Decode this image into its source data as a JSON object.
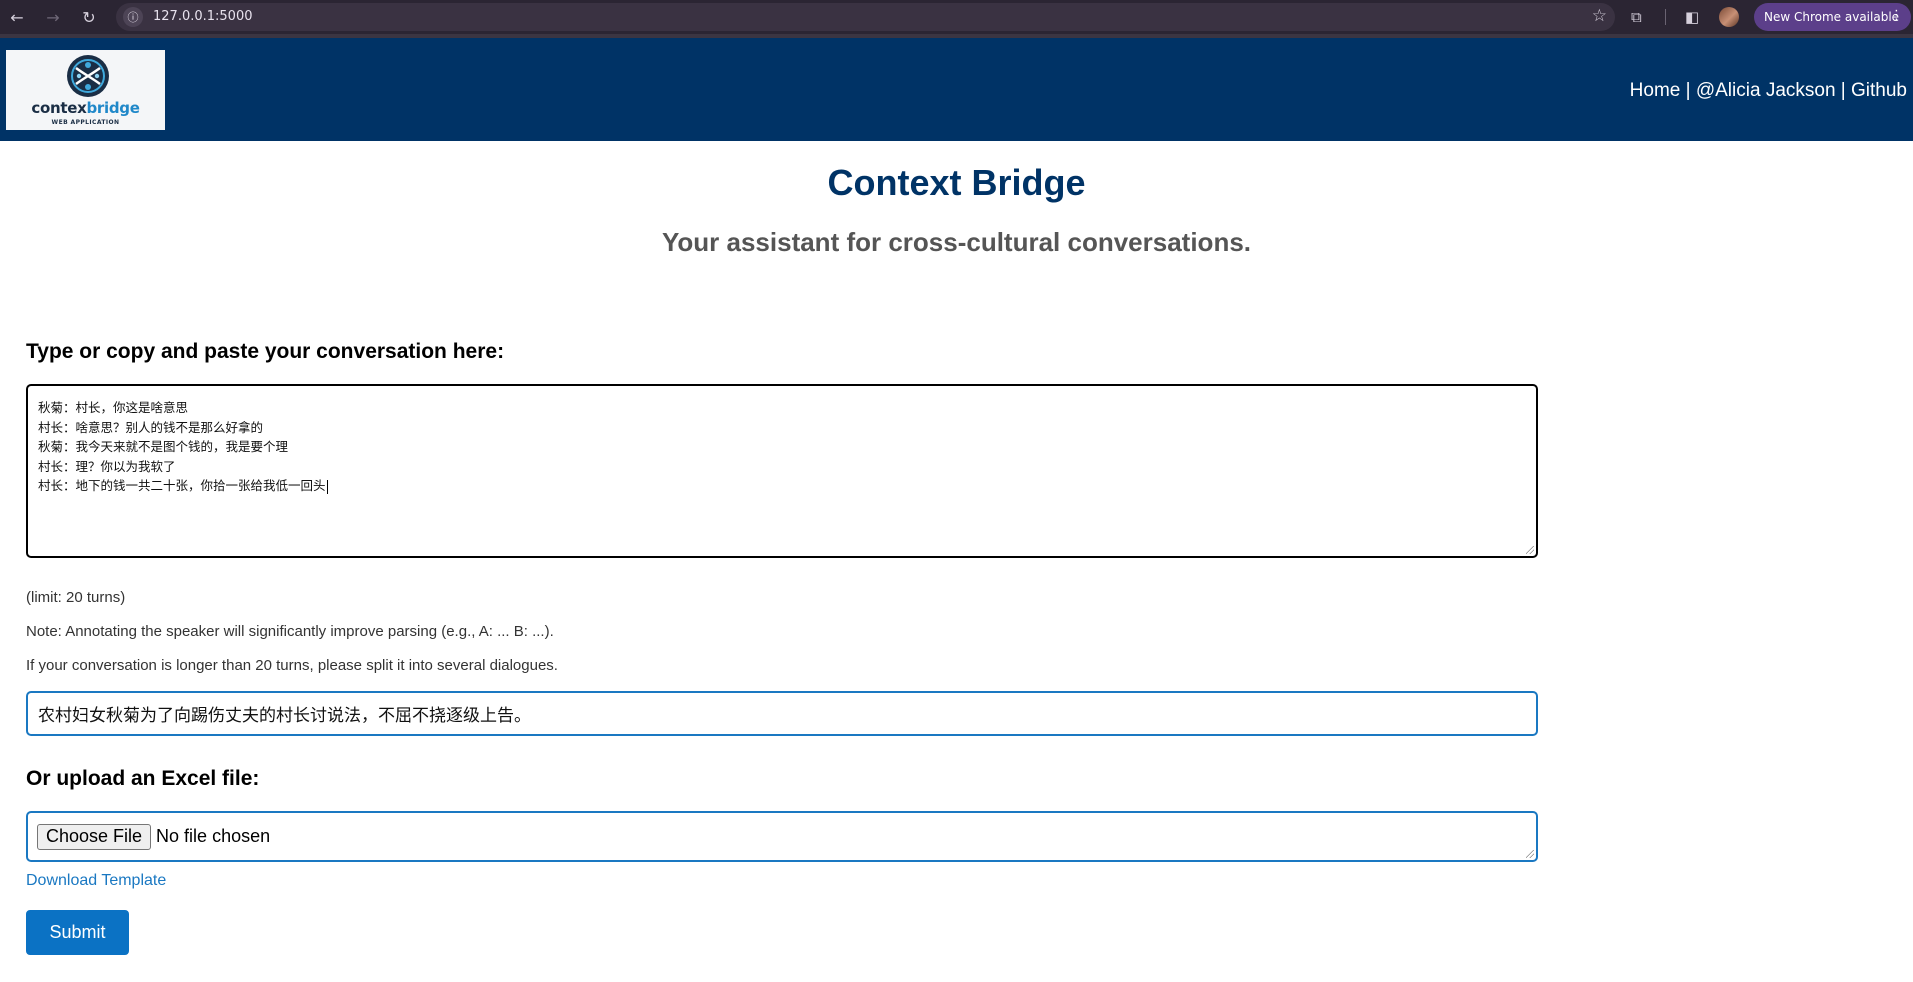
{
  "browser": {
    "url": "127.0.0.1:5000",
    "update_label": "New Chrome available",
    "icons": [
      "back-arrow-icon",
      "forward-arrow-icon",
      "reload-icon",
      "site-info-icon",
      "bookmark-star-icon",
      "extensions-icon",
      "side-panel-icon",
      "profile-avatar",
      "menu-dots-icon"
    ]
  },
  "header": {
    "logo_text_main": "contex",
    "logo_text_accent": "bridge",
    "logo_subtext": "WEB APPLICATION",
    "nav": [
      "Home",
      "@Alicia Jackson",
      "Github"
    ],
    "nav_separator": " | "
  },
  "main": {
    "title": "Context Bridge",
    "subtitle": "Your assistant for cross-cultural conversations.",
    "conversation_label": "Type or copy and paste your conversation here:",
    "conversation_lines": [
      "秋菊：村长，你这是啥意思",
      "村长：啥意思？别人的钱不是那么好拿的",
      "秋菊：我今天来就不是图个钱的，我是要个理",
      "村长：理？你以为我软了",
      "村长：地下的钱一共二十张，你拾一张给我低一回头"
    ],
    "limit_note": "(limit: 20 turns)",
    "annotation_note": "Note: Annotating the speaker will significantly improve parsing (e.g., A: ... B: ...).",
    "split_note": "If your conversation is longer than 20 turns, please split it into several dialogues.",
    "context_value": "农村妇女秋菊为了向踢伤丈夫的村长讨说法，不屈不挠逐级上告。",
    "upload_label": "Or upload an Excel file:",
    "file_button": "Choose File",
    "file_status": "No file chosen",
    "template_link": "Download Template",
    "submit_label": "Submit"
  },
  "colors": {
    "header_bg": "#003366",
    "title": "#003366",
    "accent": "#1a78c2",
    "submit_bg": "#0b72c4",
    "chrome_bg": "#2b2533",
    "update_pill": "#5c3f8a"
  }
}
